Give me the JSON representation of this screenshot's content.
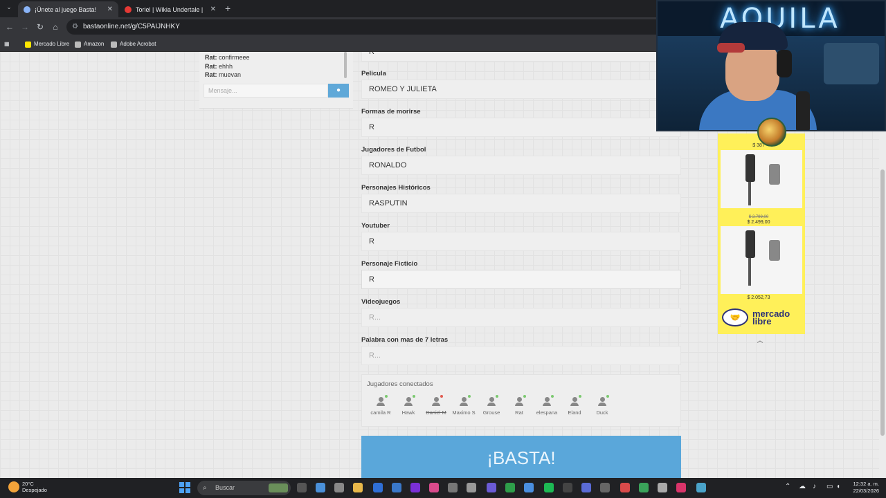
{
  "browser": {
    "tabs": [
      {
        "title": "¡Únete al juego Basta!",
        "favicon_color": "#8ab4f8"
      },
      {
        "title": "Toriel | Wikia Undertale | Fandom",
        "favicon_color": "#e53935"
      }
    ],
    "close_glyph": "✕",
    "new_tab_glyph": "+",
    "url": "bastaonline.net/g/C5PAIJNHKY",
    "bookmarks": [
      {
        "label": "Mercado Libre",
        "color": "#ffe600"
      },
      {
        "label": "Amazon",
        "color": "#bbbbbb"
      },
      {
        "label": "Adobe Acrobat",
        "color": "#bbbbbb"
      }
    ]
  },
  "chat": {
    "messages": [
      {
        "user": "Rat:",
        "text": "confirmeee"
      },
      {
        "user": "Rat:",
        "text": "ehhh"
      },
      {
        "user": "Rat:",
        "text": "muevan"
      }
    ],
    "placeholder": "Mensaje...",
    "send_icon": "chat-bubble-icon"
  },
  "categories": [
    {
      "label": "Pelicula",
      "value": "ROMEO Y JULIETA",
      "empty": false
    },
    {
      "label": "Formas de morirse",
      "value": "R",
      "empty": false
    },
    {
      "label": "Jugadores de Futbol",
      "value": "RONALDO",
      "empty": false
    },
    {
      "label": "Personajes Históricos",
      "value": "RASPUTIN",
      "empty": false
    },
    {
      "label": "Youtuber",
      "value": "R",
      "empty": false
    },
    {
      "label": "Personaje Ficticio",
      "value": "R",
      "empty": false
    },
    {
      "label": "Videojuegos",
      "value": "R...",
      "empty": true
    },
    {
      "label": "Palabra con mas de 7 letras",
      "value": "R...",
      "empty": true
    }
  ],
  "top_partial_value": "R",
  "players": {
    "title": "Jugadores conectados",
    "list": [
      {
        "name": "camila R",
        "status_color": "#7bc96f"
      },
      {
        "name": "Hawk",
        "status_color": "#7bc96f"
      },
      {
        "name": "Daniel M",
        "status_color": "#e05a4f"
      },
      {
        "name": "Maximo S",
        "status_color": "#7bc96f"
      },
      {
        "name": "Grouse",
        "status_color": "#7bc96f"
      },
      {
        "name": "Rat",
        "status_color": "#7bc96f"
      },
      {
        "name": "elespana",
        "status_color": "#7bc96f"
      },
      {
        "name": "Eland",
        "status_color": "#7bc96f"
      },
      {
        "name": "Duck",
        "status_color": "#7bc96f"
      }
    ]
  },
  "basta_button": "¡BASTA!",
  "ad": {
    "prices": [
      "$ 387",
      "$ 2.499,00",
      "$ 2.052,73"
    ],
    "old_price": "$ 2.799,00",
    "logo_text_1": "mercado",
    "logo_text_2": "libre",
    "collapse_glyph": "︿"
  },
  "webcam": {
    "neon_text": "AQUILA"
  },
  "taskbar": {
    "temperature": "20°C",
    "weather": "Despejado",
    "search_label": "Buscar",
    "time": "12:32 a. m.",
    "date": "22/03/2026"
  }
}
